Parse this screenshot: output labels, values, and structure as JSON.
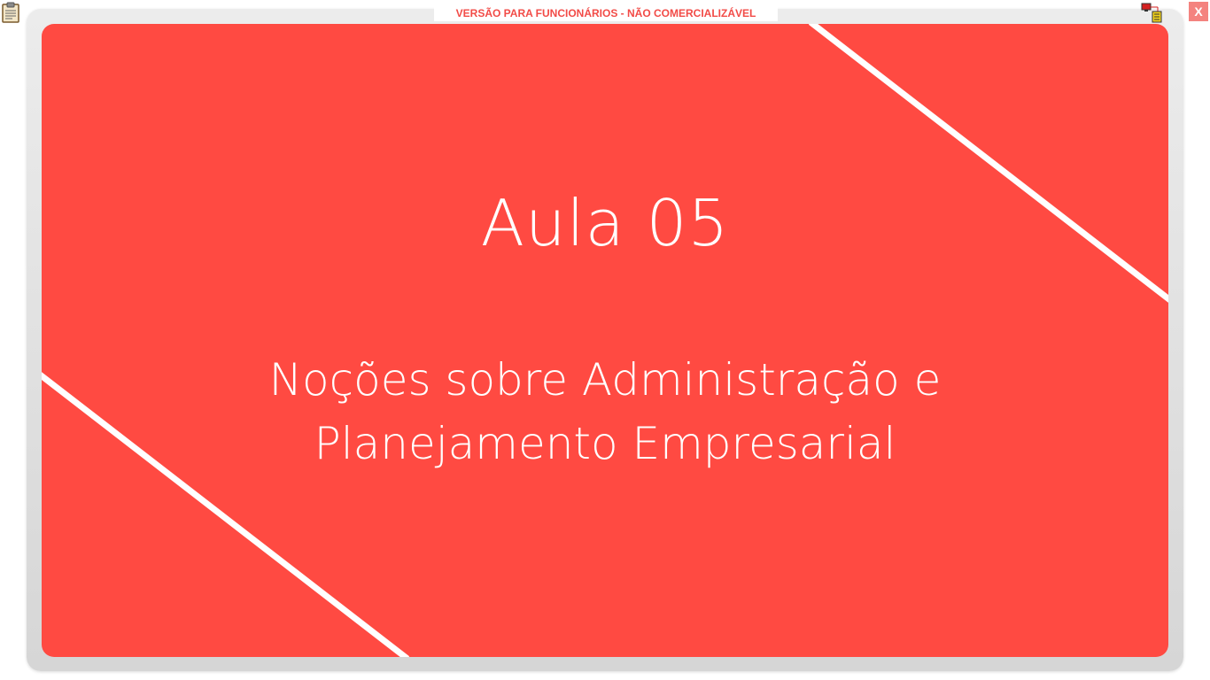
{
  "banner": {
    "text": "VERSÃO PARA FUNCIONÁRIOS - NÃO COMERCIALIZÁVEL"
  },
  "controls": {
    "close_label": "X",
    "clipboard_icon": "clipboard-icon",
    "network_icon": "network-status-icon"
  },
  "slide": {
    "title": "Aula 05",
    "subtitle_line1": "Noções sobre Administração e",
    "subtitle_line2": "Planejamento Empresarial",
    "background_color": "#ff4a42",
    "stripe_color": "#ffffff"
  }
}
